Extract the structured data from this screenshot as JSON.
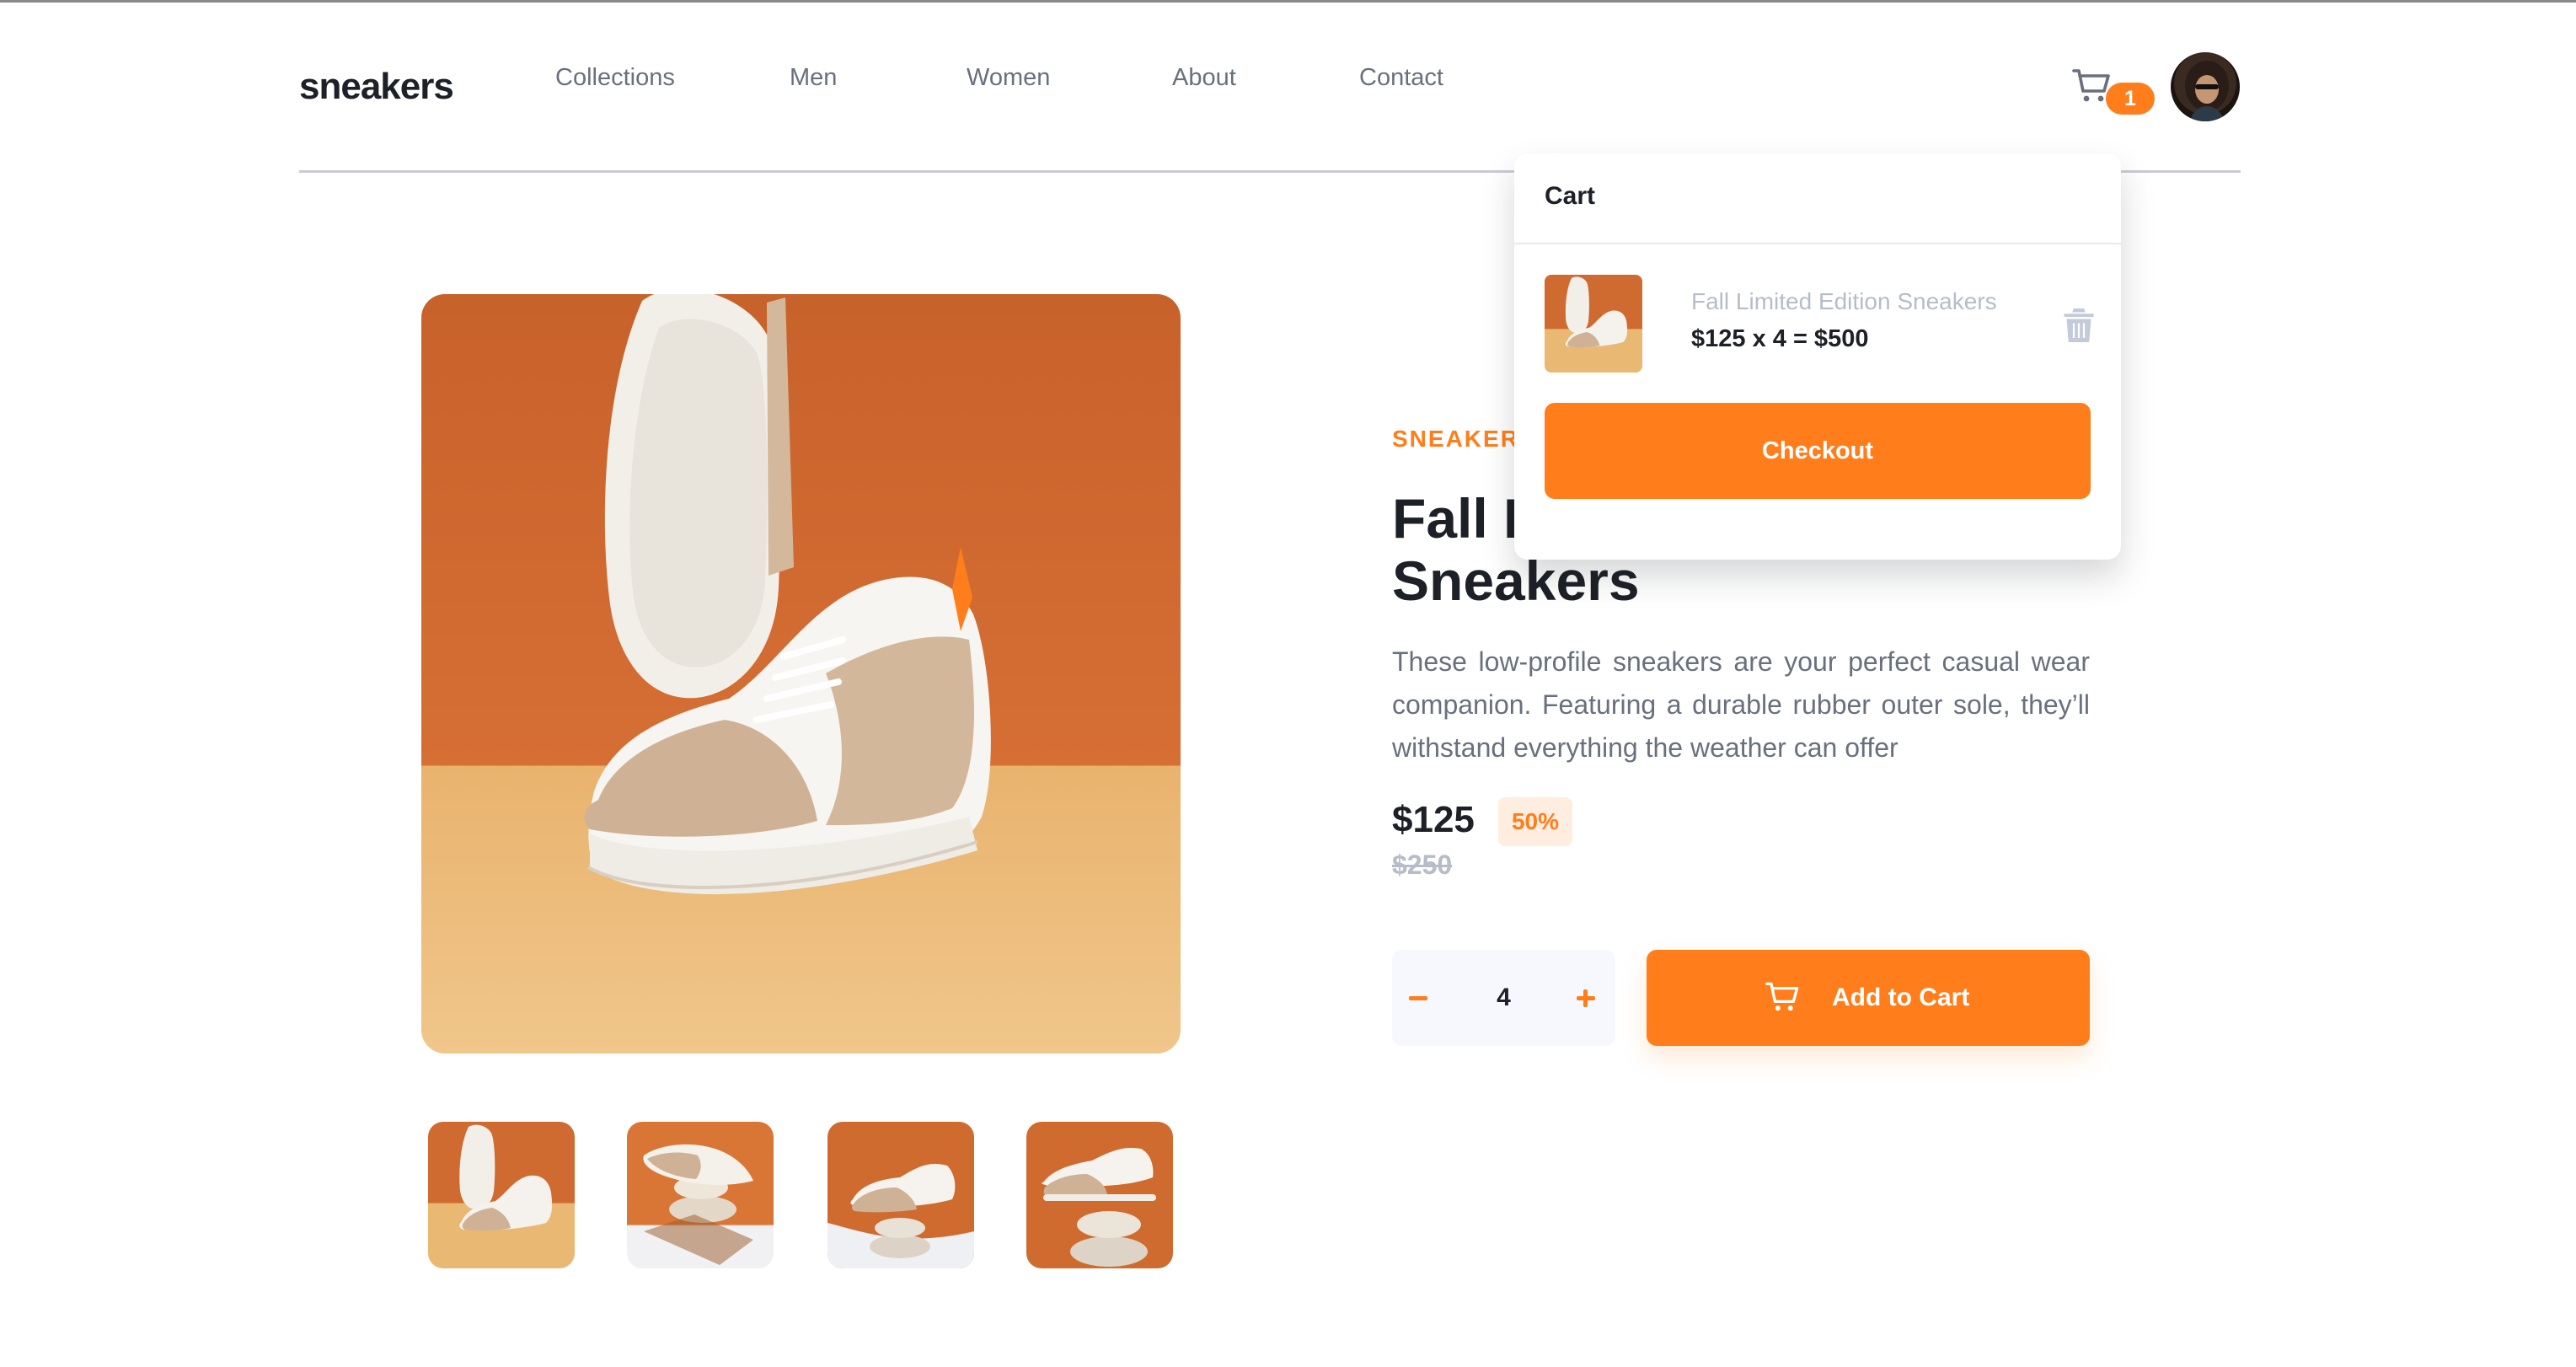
{
  "brand": {
    "logo": "sneakers",
    "accent": "#ff7e1b"
  },
  "nav": {
    "items": [
      "Collections",
      "Men",
      "Women",
      "About",
      "Contact"
    ]
  },
  "header": {
    "cart_icon": "cart-icon",
    "cart_count": "1",
    "avatar_icon": "user-avatar"
  },
  "product": {
    "company": "SNEAKER COMPANY",
    "title": "Fall Limited Edition Sneakers",
    "description": "These low-profile sneakers are your perfect casual wear companion. Featuring a durable rubber outer sole, they’ll withstand everything the weather can offer",
    "price": "$125",
    "discount": "50%",
    "original_price": "$250",
    "quantity": "4",
    "add_to_cart_label": "Add to Cart",
    "gallery": {
      "thumbnail_count": 4,
      "selected_thumbnail": 0
    }
  },
  "cart": {
    "heading": "Cart",
    "item": {
      "name": "Fall Limited Edition Sneakers",
      "line_total": "$125 x 4 = $500"
    },
    "delete_icon": "trash-icon",
    "checkout_label": "Checkout"
  }
}
